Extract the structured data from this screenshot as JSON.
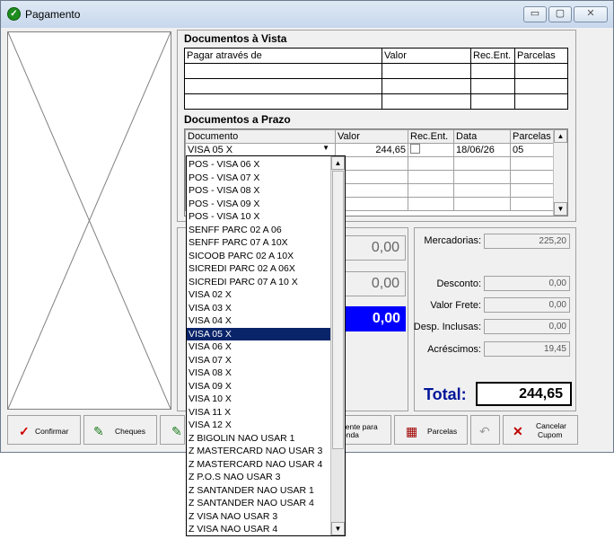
{
  "window": {
    "title": "Pagamento",
    "min_glyph": "▭",
    "max_glyph": "▢",
    "close_glyph": "✕"
  },
  "avista": {
    "title": "Documentos à Vista",
    "headers": [
      "Pagar através de",
      "Valor",
      "Rec.Ent.",
      "Parcelas"
    ]
  },
  "aprazo": {
    "title": "Documentos a Prazo",
    "headers": [
      "Documento",
      "Valor",
      "Rec.Ent.",
      "Data",
      "Parcelas"
    ],
    "row": {
      "documento": "VISA 05 X",
      "valor": "244,65",
      "data": "18/06/26",
      "parcelas": "05"
    }
  },
  "dropdown": {
    "items": [
      "POS - VISA 06 X",
      "POS - VISA 07 X",
      "POS - VISA 08 X",
      "POS - VISA 09 X",
      "POS - VISA 10 X",
      "SENFF PARC 02 A 06",
      "SENFF PARC 07 A 10X",
      "SICOOB PARC 02 A 10X",
      "SICREDI PARC 02 A 06X",
      "SICREDI PARC 07 A 10 X",
      "VISA 02 X",
      "VISA 03 X",
      "VISA 04 X",
      "VISA 05 X",
      "VISA 06 X",
      "VISA 07 X",
      "VISA 08 X",
      "VISA 09 X",
      "VISA 10 X",
      "VISA 11 X",
      "VISA 12 X",
      "Z BIGOLIN NAO USAR 1",
      "Z MASTERCARD NAO USAR 3",
      "Z MASTERCARD NAO USAR 4",
      "Z P.O.S NAO USAR 3",
      "Z SANTANDER NAO USAR 1",
      "Z SANTANDER NAO USAR 4",
      "Z VISA NAO USAR 3",
      "Z VISA NAO USAR 4"
    ],
    "selected_index": 13
  },
  "middle": {
    "field1": "0,00",
    "field2": "0,00",
    "field3": "0,00"
  },
  "summary": {
    "mercadorias_label": "Mercadorias:",
    "mercadorias": "225,20",
    "desconto_label": "Desconto:",
    "desconto": "0,00",
    "frete_label": "Valor Frete:",
    "frete": "0,00",
    "despesas_label": "Desp. Inclusas:",
    "despesas": "0,00",
    "acrescimos_label": "Acréscimos:",
    "acrescimos": "19,45",
    "total_label": "Total:",
    "total": "244,65"
  },
  "buttons": {
    "confirmar": "Confirmar",
    "cheques": "Cheques",
    "cliente_line1": "liente para",
    "cliente_line2": "enda",
    "parcelas": "Parcelas",
    "cancelar_line1": "Cancelar",
    "cancelar_line2": "Cupom"
  },
  "colors": {
    "accent_blue": "#0000ff",
    "selection": "#0a246a",
    "total_text": "#00159a"
  }
}
